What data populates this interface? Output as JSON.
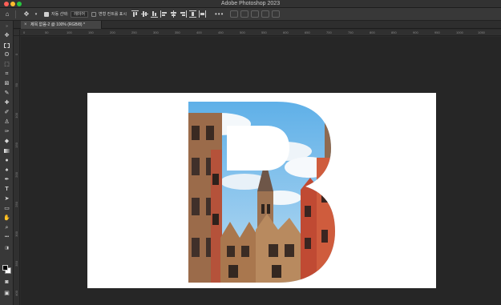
{
  "app": {
    "title": "Adobe Photoshop 2023"
  },
  "options_bar": {
    "auto_select_label": "자동 선택:",
    "auto_select_value": "레이어",
    "show_transform_label": "변형 컨트롤 표시",
    "more": "•••"
  },
  "document": {
    "tab_title": "제목 없음-2 @ 100% (RGB/8) *",
    "tab_close": "×"
  },
  "rulers": {
    "top": [
      "0",
      "50",
      "100",
      "150",
      "200",
      "250",
      "300",
      "350",
      "400",
      "450",
      "500",
      "550",
      "600",
      "650",
      "700",
      "750",
      "800",
      "850",
      "900",
      "950",
      "1000",
      "1050"
    ],
    "left": [
      "0",
      "50",
      "100",
      "150",
      "200",
      "250",
      "300",
      "350",
      "400"
    ]
  },
  "icons": {
    "home": "home-icon",
    "move": "move-tool-icon",
    "colors": {
      "tab": "#444444",
      "canvas": "#ffffff",
      "workspace": "#262626",
      "sky": "#7dbde6"
    }
  }
}
